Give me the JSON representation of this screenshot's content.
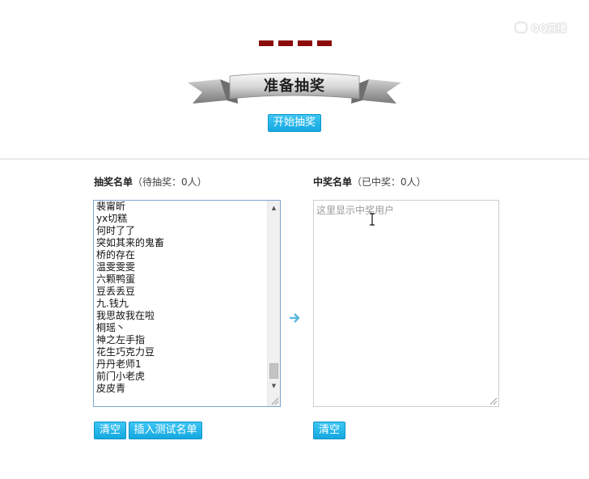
{
  "watermark": {
    "text": "QQ直播"
  },
  "banner": {
    "title": "准备抽奖"
  },
  "start_button": {
    "label": "开始抽奖"
  },
  "left_panel": {
    "heading_bold": "抽奖名单",
    "heading_note": "（待抽奖：0人）",
    "names": [
      "裴甯昕",
      "yx切糕",
      "何时了了",
      "突如其来的鬼畜",
      "桥的存在",
      "温雯雯雯",
      "六颗鸭蛋",
      "豆丢丢豆",
      "九.钱九",
      "我思故我在啦",
      "桐瑶丶",
      "神之左手指",
      "花生巧克力豆",
      "丹丹老师1",
      "前门小老虎",
      "皮皮青"
    ],
    "clear_label": "清空",
    "insert_label": "插入测试名单"
  },
  "right_panel": {
    "heading_bold": "中奖名单",
    "heading_note": "（已中奖：0人）",
    "placeholder": "这里显示中奖用户",
    "clear_label": "清空"
  },
  "colors": {
    "accent_blue": "#14a8e0",
    "dash_red": "#8b0a0a",
    "list_border": "#7da2ce"
  },
  "icons": {
    "mid_arrow": "arrow-right-icon",
    "text_cursor": "i-beam-cursor-icon"
  }
}
